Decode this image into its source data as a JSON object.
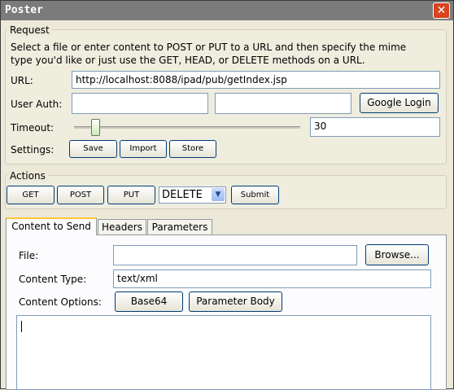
{
  "window": {
    "title": "Poster",
    "close_glyph": "✕"
  },
  "request": {
    "legend": "Request",
    "description_line1": "Select a file or enter content to POST or PUT to a URL and then specify the mime",
    "description_line2": "type you'd like or just use the GET, HEAD, or DELETE methods on a URL.",
    "url_label": "URL:",
    "url_value": "http://localhost:8088/ipad/pub/getIndex.jsp",
    "user_auth_label": "User Auth:",
    "user_value": "",
    "password_value": "",
    "google_login_label": "Google Login",
    "timeout_label": "Timeout:",
    "timeout_value": "30",
    "settings_label": "Settings:",
    "save_label": "Save",
    "import_label": "Import",
    "store_label": "Store"
  },
  "actions": {
    "legend": "Actions",
    "get_label": "GET",
    "post_label": "POST",
    "put_label": "PUT",
    "method_selected": "DELETE",
    "submit_label": "Submit"
  },
  "tabs": [
    {
      "label": "Content to Send",
      "active": true
    },
    {
      "label": "Headers",
      "active": false
    },
    {
      "label": "Parameters",
      "active": false
    }
  ],
  "content": {
    "file_label": "File:",
    "file_value": "",
    "browse_label": "Browse...",
    "content_type_label": "Content Type:",
    "content_type_value": "text/xml",
    "content_options_label": "Content Options:",
    "base64_label": "Base64",
    "parameter_body_label": "Parameter Body",
    "body_value": ""
  },
  "icons": {
    "close": "close-icon",
    "dropdown": "chevron-down-icon"
  }
}
